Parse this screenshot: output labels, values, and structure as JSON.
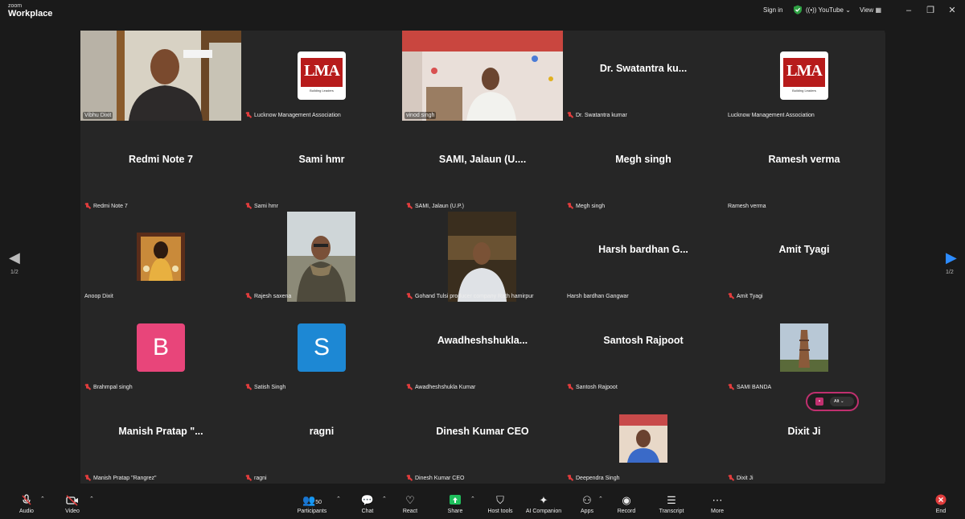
{
  "app": {
    "brand_small": "zoom",
    "brand_large": "Workplace"
  },
  "topbar": {
    "sign_in": "Sign in",
    "youtube": "YouTube",
    "view": "View"
  },
  "tiles": [
    {
      "display": "",
      "label": "Vibhu Dixit",
      "type": "video",
      "muted": false
    },
    {
      "display": "",
      "label": "Lucknow Management Association",
      "type": "logo",
      "muted": true
    },
    {
      "display": "",
      "label": "vinod singh",
      "type": "video",
      "muted": false
    },
    {
      "display": "Dr. Swatantra ku...",
      "label": "Dr. Swatantra kumar",
      "type": "name",
      "muted": true
    },
    {
      "display": "",
      "label": "Lucknow Management Association",
      "type": "logo",
      "muted": false
    },
    {
      "display": "Redmi Note 7",
      "label": "Redmi Note 7",
      "type": "name",
      "muted": true
    },
    {
      "display": "Sami hmr",
      "label": "Sami hmr",
      "type": "name",
      "muted": true
    },
    {
      "display": "SAMI,  Jalaun  (U....",
      "label": "SAMI, Jalaun (U.P.)",
      "type": "name",
      "muted": true
    },
    {
      "display": "Megh singh",
      "label": "Megh singh",
      "type": "name",
      "muted": true
    },
    {
      "display": "Ramesh verma",
      "label": "Ramesh verma",
      "type": "name",
      "muted": false
    },
    {
      "display": "",
      "label": "Anoop Dixit",
      "type": "avatar",
      "muted": false
    },
    {
      "display": "",
      "label": "Rajesh saxena",
      "type": "video",
      "muted": true
    },
    {
      "display": "",
      "label": "Gohand Tulsi producer company Rath hamirpur",
      "type": "video",
      "muted": true
    },
    {
      "display": "Harsh bardhan G...",
      "label": "Harsh bardhan Gangwar",
      "type": "name",
      "muted": false
    },
    {
      "display": "Amit Tyagi",
      "label": "Amit Tyagi",
      "type": "name",
      "muted": true
    },
    {
      "display": "B",
      "label": "Brahmpal singh",
      "type": "letter",
      "color": "#e8457a",
      "muted": true
    },
    {
      "display": "S",
      "label": "Satish Singh",
      "type": "letter",
      "color": "#1d88d4",
      "muted": true
    },
    {
      "display": "Awadheshshukla...",
      "label": "Awadheshshukla Kumar",
      "type": "name",
      "muted": true
    },
    {
      "display": "Santosh Rajpoot",
      "label": "Santosh Rajpoot",
      "type": "name",
      "muted": true
    },
    {
      "display": "",
      "label": "SAMI BANDA",
      "type": "avatar",
      "muted": true
    },
    {
      "display": "Manish Pratap  \"...",
      "label": "Manish Pratap \"Rangrez\"",
      "type": "name",
      "muted": true
    },
    {
      "display": "ragni",
      "label": "ragni",
      "type": "name",
      "muted": true
    },
    {
      "display": "Dinesh Kumar CEO",
      "label": "Dinesh Kumar CEO",
      "type": "name",
      "muted": true
    },
    {
      "display": "",
      "label": "Deependra Singh",
      "type": "avatar",
      "muted": true
    },
    {
      "display": "Dixit Ji",
      "label": "Dixit Ji",
      "type": "name",
      "muted": true
    }
  ],
  "logo": {
    "text": "LMA",
    "sub": "Building Leaders"
  },
  "pagination": {
    "left": "1/2",
    "right": "1/2"
  },
  "float_pill": {
    "label": "Alt"
  },
  "toolbar": {
    "audio": "Audio",
    "video": "Video",
    "participants": "Participants",
    "participants_count": "50",
    "chat": "Chat",
    "react": "React",
    "share": "Share",
    "host_tools": "Host tools",
    "ai_companion": "AI Companion",
    "apps": "Apps",
    "record": "Record",
    "transcript": "Transcript",
    "more": "More",
    "end": "End"
  },
  "colors": {
    "active_speaker": "#3ec463",
    "mute": "#e03c3c",
    "share": "#1fbf5c",
    "end": "#e03c3c",
    "nav_arrow": "#2d8cff"
  }
}
